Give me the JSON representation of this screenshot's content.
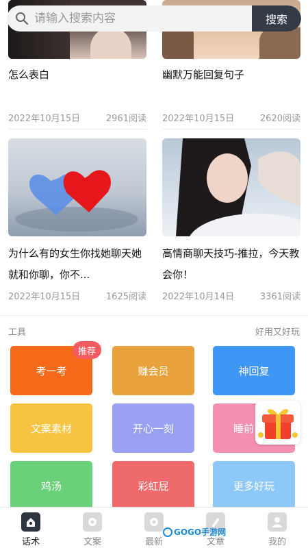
{
  "search": {
    "placeholder": "请输入搜索内容",
    "button_label": "搜索"
  },
  "articles": [
    {
      "title": "怎么表白",
      "date": "2022年10月15日",
      "reads": "2961阅读"
    },
    {
      "title": "幽默万能回复句子",
      "date": "2022年10月15日",
      "reads": "2620阅读"
    },
    {
      "title": "为什么有的女生你找她聊天她就和你聊，你不...",
      "date": "2022年10月15日",
      "reads": "1625阅读"
    },
    {
      "title": "高情商聊天技巧-推拉，今天教会你！",
      "date": "2022年10月14日",
      "reads": "3361阅读"
    }
  ],
  "tools": {
    "title": "工具",
    "subtitle": "好用又好玩",
    "badge": "推荐",
    "items": [
      {
        "label": "考一考",
        "color": "#f46a19"
      },
      {
        "label": "赚会员",
        "color": "#e9a23b"
      },
      {
        "label": "神回复",
        "color": "#3e97f4"
      },
      {
        "label": "文案素材",
        "color": "#f7c442"
      },
      {
        "label": "开心一刻",
        "color": "#9aa1f2"
      },
      {
        "label": "睡前",
        "color": "#f48fb1"
      },
      {
        "label": "鸡汤",
        "color": "#6ad07a"
      },
      {
        "label": "彩虹屁",
        "color": "#ef6a6a"
      },
      {
        "label": "更多好玩",
        "color": "#8ec8f8"
      }
    ]
  },
  "tabs": [
    {
      "label": "话术",
      "icon": "home-icon",
      "active": true
    },
    {
      "label": "文案",
      "icon": "document-icon",
      "active": false
    },
    {
      "label": "最新",
      "icon": "clock-icon",
      "active": false
    },
    {
      "label": "文章",
      "icon": "pen-icon",
      "active": false
    },
    {
      "label": "我的",
      "icon": "user-icon",
      "active": false
    }
  ],
  "watermark": "GOGO手游网"
}
